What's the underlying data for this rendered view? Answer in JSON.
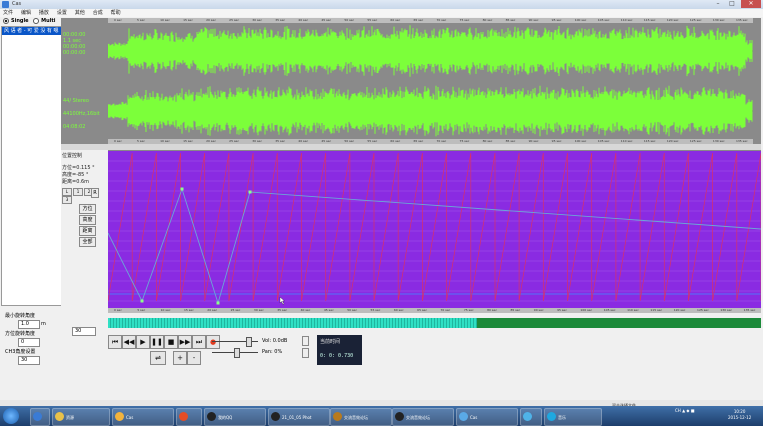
{
  "window": {
    "title": "Cas",
    "minimize": "–",
    "maximize": "□",
    "close": "✕"
  },
  "menu": [
    "文件",
    "编辑",
    "播放",
    "设置",
    "其他",
    "合成",
    "帮助"
  ],
  "modes": {
    "single": "Single",
    "multi": "Multi",
    "selected": "single"
  },
  "file_list": {
    "selected_item": "风 语 者 - 可 爱 没 有 嗯"
  },
  "wave_info": {
    "lines_top": [
      "00:00:00",
      "1.1 sec",
      "00:00:00",
      "00:00:00"
    ],
    "format": "44/ Stereo",
    "rate": "44100Hz,16bit",
    "duration": "04:08:02",
    "wave_color": "#7cff3a"
  },
  "ruler_labels": [
    "0 sec",
    "5 sec",
    "10 sec",
    "15 sec",
    "20 sec",
    "25 sec",
    "30 sec",
    "35 sec",
    "40 sec",
    "45 sec",
    "50 sec",
    "55 sec",
    "60 sec",
    "65 sec",
    "70 sec",
    "75 sec",
    "80 sec",
    "85 sec",
    "90 sec",
    "95 sec",
    "100 sec",
    "105 sec",
    "110 sec",
    "115 sec",
    "120 sec",
    "125 sec",
    "130 sec",
    "135 sec"
  ],
  "position_panel": {
    "header": "位置控制",
    "line1": "方位=0.115 °",
    "line2": "高度=-85 °",
    "line3": "距离=0.6m",
    "small_buttons": [
      "L",
      "1",
      "2",
      "3",
      "R"
    ],
    "buttons": [
      "方位",
      "高度",
      "距离",
      "全部"
    ],
    "plot_color": "#8a2be2"
  },
  "progress": {
    "fraction": 0.565,
    "color": "#2fe0c4",
    "track": "#1c8a3a"
  },
  "transport": {
    "buttons": [
      "⏮",
      "◀◀",
      "▶",
      "❚❚",
      "■",
      "▶▶",
      "⏭",
      "●"
    ],
    "vol_label": "Vol: 0.0dB",
    "pan_label": "Pan: 0%",
    "side_buttons": [
      "⇌",
      "+",
      "-"
    ]
  },
  "time_box": {
    "label": "当前时间",
    "value": "0: 0: 0.730"
  },
  "left_bottom": {
    "label1": "最小旋转角度",
    "value1": "1.0",
    "unit1": "m",
    "label2": "方位旋转角度",
    "value2": "0",
    "label3": "CH3角度设置",
    "value3": "30",
    "box": "30"
  },
  "status_hint": "双击选择文件",
  "taskbar": {
    "items": [
      {
        "label": "",
        "color": "#3a7bd5"
      },
      {
        "label": "资源",
        "color": "#e8c14a"
      },
      {
        "label": "Cas",
        "color": "#f2b33d"
      },
      {
        "label": "",
        "color": "#e44d26"
      },
      {
        "label": "我的QQ",
        "color": "#222"
      },
      {
        "label": "21_01_05 Phot",
        "color": "#222"
      },
      {
        "label": "交流音效论坛",
        "color": "#b87a1e"
      },
      {
        "label": "交流音效论坛",
        "color": "#222"
      },
      {
        "label": "Cas",
        "color": "#5aa9e6"
      },
      {
        "label": "",
        "color": "#4fb3e8"
      },
      {
        "label": "音乐",
        "color": "#1ea8e0"
      }
    ],
    "clock_time": "10:20",
    "clock_date": "2015-12-12",
    "tray": "CH  ▲ ◆ ■"
  }
}
